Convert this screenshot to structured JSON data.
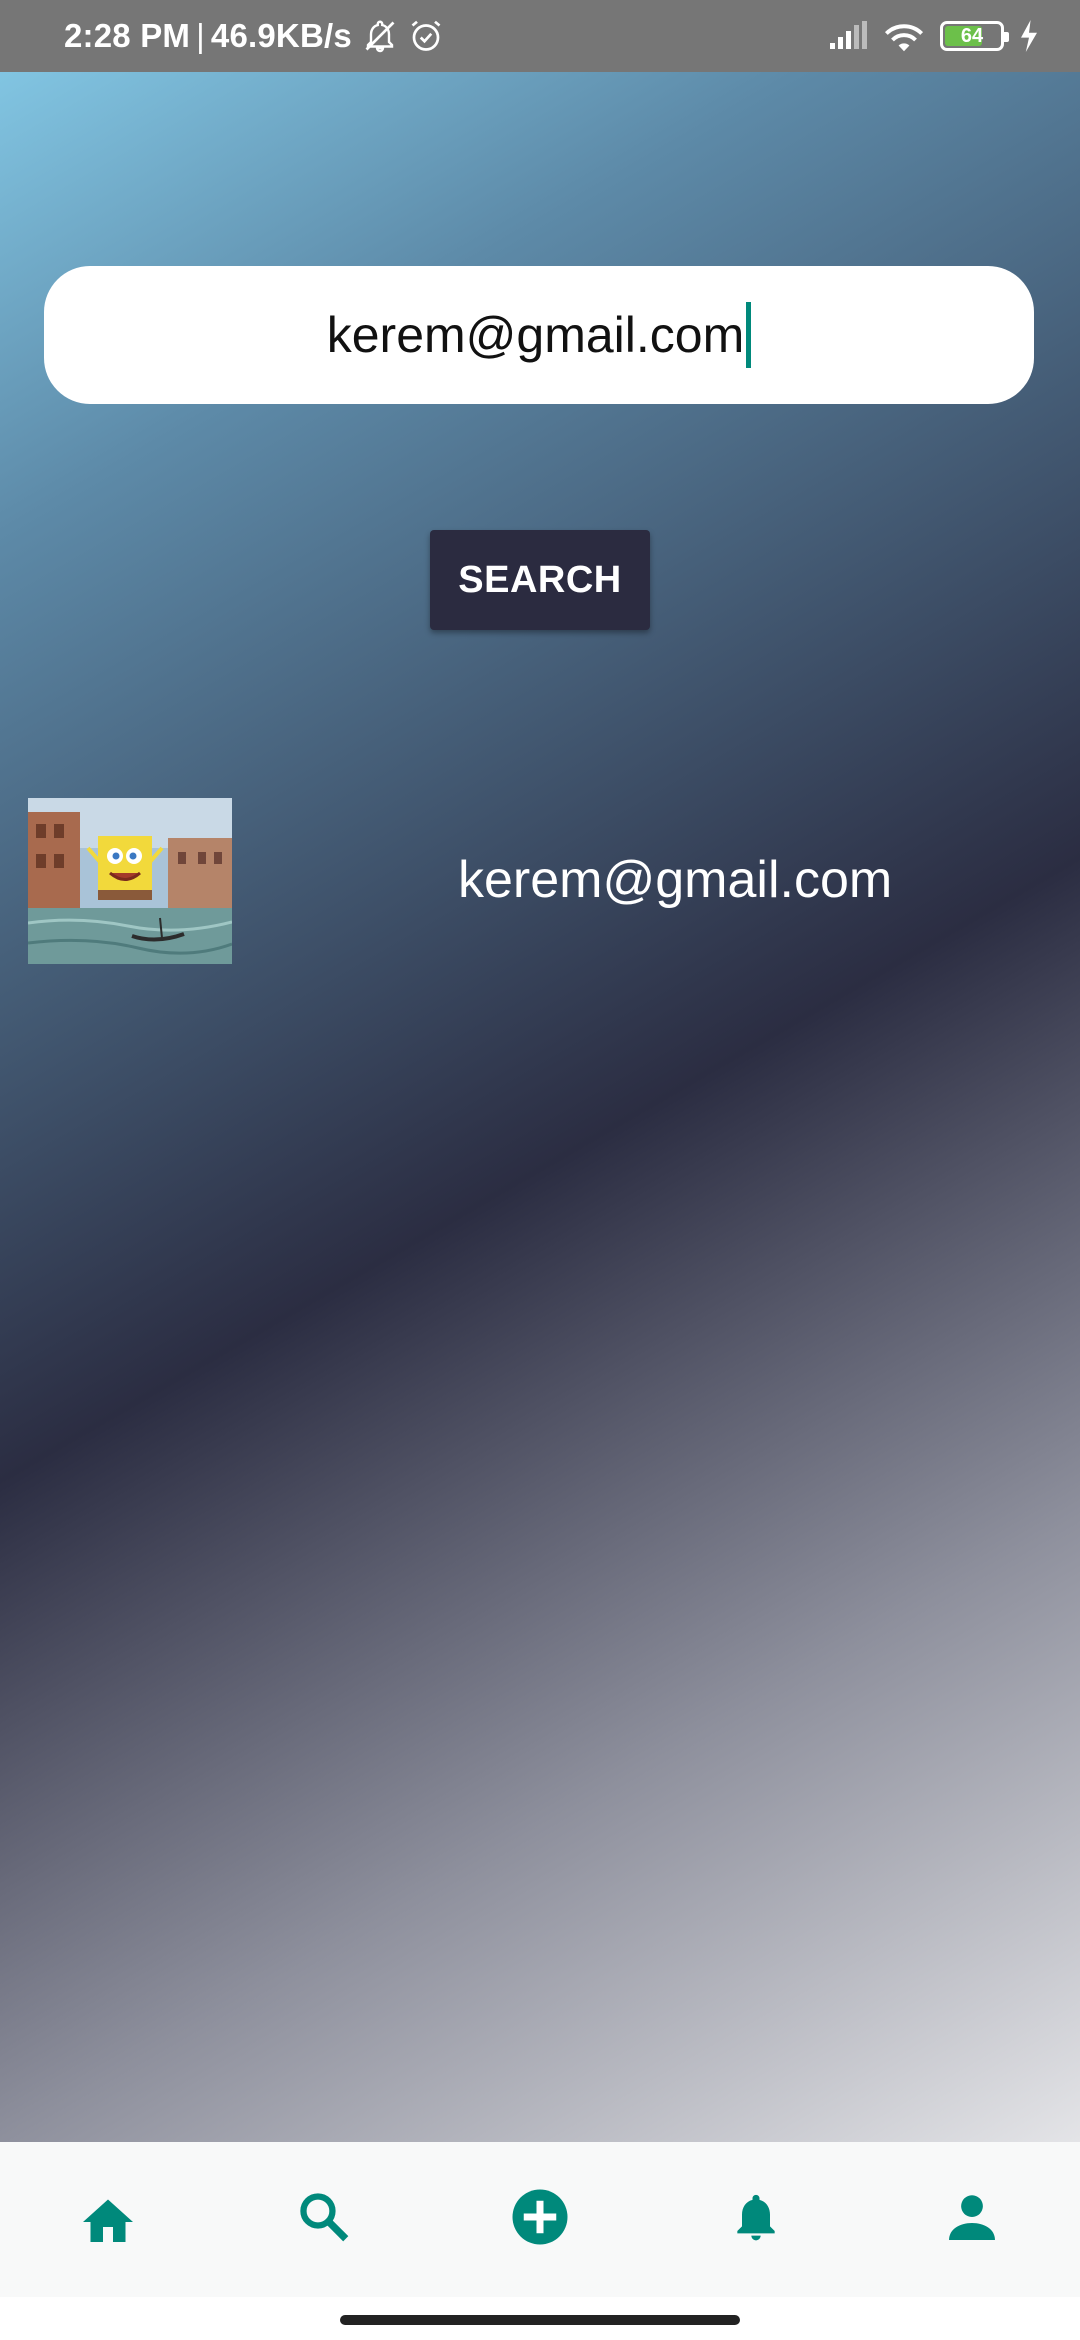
{
  "status_bar": {
    "time": "2:28 PM",
    "separator": "|",
    "net_speed": "46.9KB/s",
    "battery_level": "64",
    "battery_fraction": 0.64,
    "icons": [
      "notifications-off-icon",
      "alarm-icon",
      "signal-icon",
      "wifi-icon",
      "battery-icon",
      "charging-icon"
    ]
  },
  "search": {
    "value": "kerem@gmail.com",
    "button_label": "SEARCH"
  },
  "results": [
    {
      "email": "kerem@gmail.com",
      "thumbnail": "spongebob-venice-painting"
    }
  ],
  "bottom_nav": {
    "items": [
      {
        "icon": "home-icon"
      },
      {
        "icon": "search-icon"
      },
      {
        "icon": "add-circle-icon"
      },
      {
        "icon": "notifications-icon"
      },
      {
        "icon": "profile-icon"
      }
    ],
    "accent": "#00897b"
  },
  "colors": {
    "button_bg": "#2b2b40",
    "caret": "#00897b",
    "status_bar_bg": "#767676"
  }
}
